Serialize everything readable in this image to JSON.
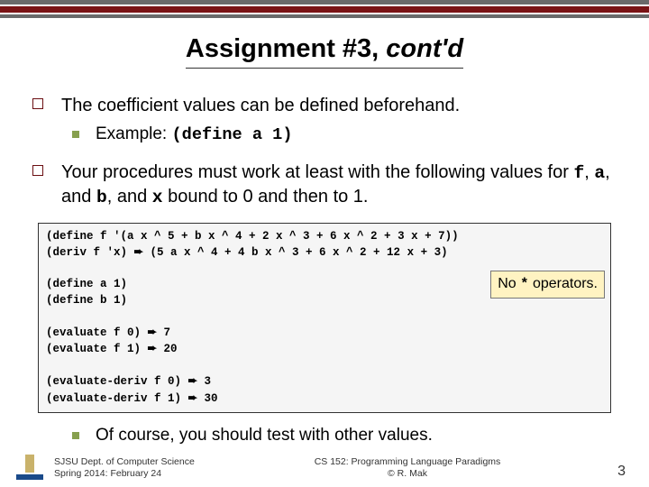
{
  "title": {
    "prefix": "Assignment #3, ",
    "suffix": "cont'd"
  },
  "bullets": {
    "b1": "The coefficient values can be defined beforehand.",
    "b1sub_prefix": "Example: ",
    "b1sub_code": "(define a 1)",
    "b2_p1": "Your procedures must work at least with the following values for ",
    "b2_c1": "f",
    "b2_p2": ", ",
    "b2_c2": "a",
    "b2_p3": ", and ",
    "b2_c3": "b",
    "b2_p4": ", and ",
    "b2_c4": "x",
    "b2_p5": " bound to 0 and then to 1.",
    "b3": "Of course, you should test with other values."
  },
  "code": {
    "l1": "(define f '(a x ^ 5 + b x ^ 4 + 2 x ^ 3 + 6 x ^ 2 + 3 x + 7))",
    "l2a": "(deriv f 'x) ",
    "l2b": " (5 a x ^ 4 + 4 b x ^ 3 + 6 x ^ 2 + 12 x + 3)",
    "l3": "(define a 1)",
    "l4": "(define b 1)",
    "l5a": "(evaluate f 0) ",
    "l5b": " 7",
    "l6a": "(evaluate f 1) ",
    "l6b": " 20",
    "l7a": "(evaluate-deriv f 0) ",
    "l7b": " 3",
    "l8a": "(evaluate-deriv f 1) ",
    "l8b": " 30",
    "arrow": "➨"
  },
  "callout": {
    "prefix": "No ",
    "op": "*",
    "suffix": " operators."
  },
  "footer": {
    "left1": "SJSU Dept. of Computer Science",
    "left2": "Spring 2014: February 24",
    "center1": "CS 152: Programming Language Paradigms",
    "center2": "© R. Mak",
    "page": "3"
  }
}
